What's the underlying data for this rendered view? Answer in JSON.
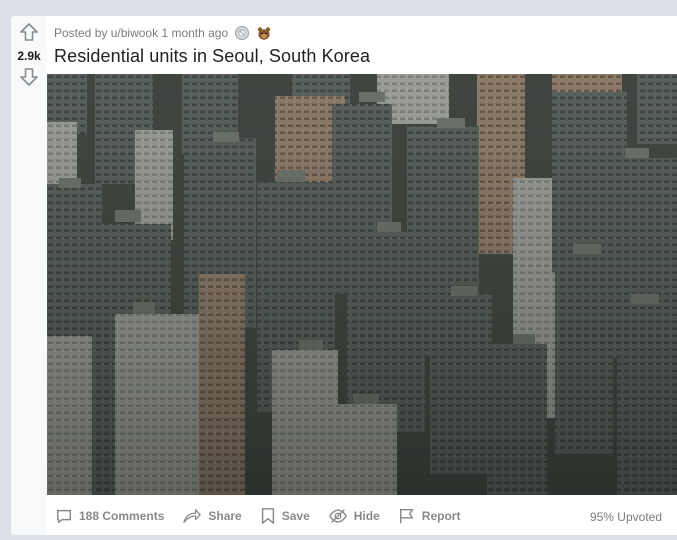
{
  "post": {
    "vote_count": "2.9k",
    "posted_by_prefix": "Posted by",
    "author": "u/biwook",
    "time_ago": "1 month ago",
    "title": "Residential units in Seoul, South Korea",
    "awards": [
      "silver-award-icon",
      "wholesome-award-icon"
    ],
    "image_alt": "Aerial view of many tall residential apartment towers in Seoul"
  },
  "actions": {
    "comments": "188 Comments",
    "share": "Share",
    "save": "Save",
    "hide": "Hide",
    "report": "Report"
  },
  "stats": {
    "upvoted": "95% Upvoted"
  },
  "colors": {
    "background": "#dae0e6",
    "card": "#ffffff",
    "vote_column": "#f8f9fa",
    "meta_text": "#787c7e",
    "action_text": "#878a8c",
    "title_text": "#222222"
  }
}
